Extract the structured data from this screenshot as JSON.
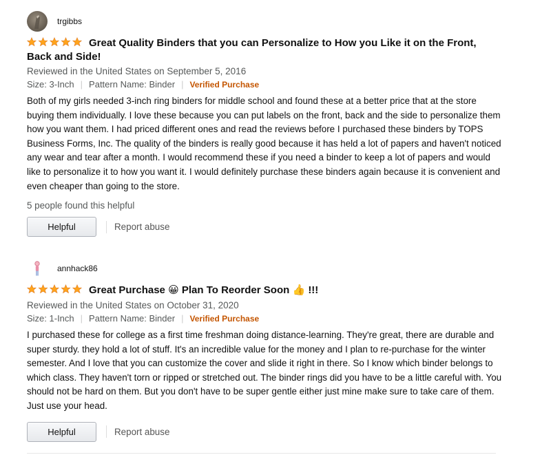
{
  "reviews": [
    {
      "username": "trgibbs",
      "rating": "5 stars",
      "title": "Great Quality Binders that you can Personalize to How you Like it on the Front, Back and Side!",
      "date": "Reviewed in the United States on September 5, 2016",
      "size": "Size: 3-Inch",
      "pattern": "Pattern Name: Binder",
      "verified": "Verified Purchase",
      "body": "Both of my girls needed 3-inch ring binders for middle school and found these at a better price that at the store buying them individually. I love these because you can put labels on the front, back and the side to personalize them how you want them. I had priced different ones and read the reviews before I purchased these binders by TOPS Business Forms, Inc. The quality of the binders is really good because it has held a lot of papers and haven't noticed any wear and tear after a month. I would recommend these if you need a binder to keep a lot of papers and would like to personalize it to how you want it. I would definitely purchase these binders again because it is convenient and even cheaper than going to the store.",
      "helpful_count": "5 people found this helpful",
      "helpful_label": "Helpful",
      "report_label": "Report abuse"
    },
    {
      "username": "annhack86",
      "rating": "5 stars",
      "title_part1": "Great Purchase",
      "title_emoji1": "😀",
      "title_part2": "Plan To Reorder Soon",
      "title_emoji2": "👍",
      "title_part3": "!!!",
      "date": "Reviewed in the United States on October 31, 2020",
      "size": "Size: 1-Inch",
      "pattern": "Pattern Name: Binder",
      "verified": "Verified Purchase",
      "body": "I purchased these for college as a first time freshman doing distance-learning. They're great, there are durable and super sturdy. they hold a lot of stuff. It's an incredible value for the money and I plan to re-purchase for the winter semester. And I love that you can customize the cover and slide it right in there. So I know which binder belongs to which class. They haven't torn or ripped or stretched out. The binder rings did you have to be a little careful with. You should not be hard on them. But you don't have to be super gentle either just mine make sure to take care of them. Just use your head.",
      "helpful_label": "Helpful",
      "report_label": "Report abuse"
    }
  ],
  "colors": {
    "star": "#ffa41c",
    "verified": "#c45500",
    "meta": "#565959"
  }
}
